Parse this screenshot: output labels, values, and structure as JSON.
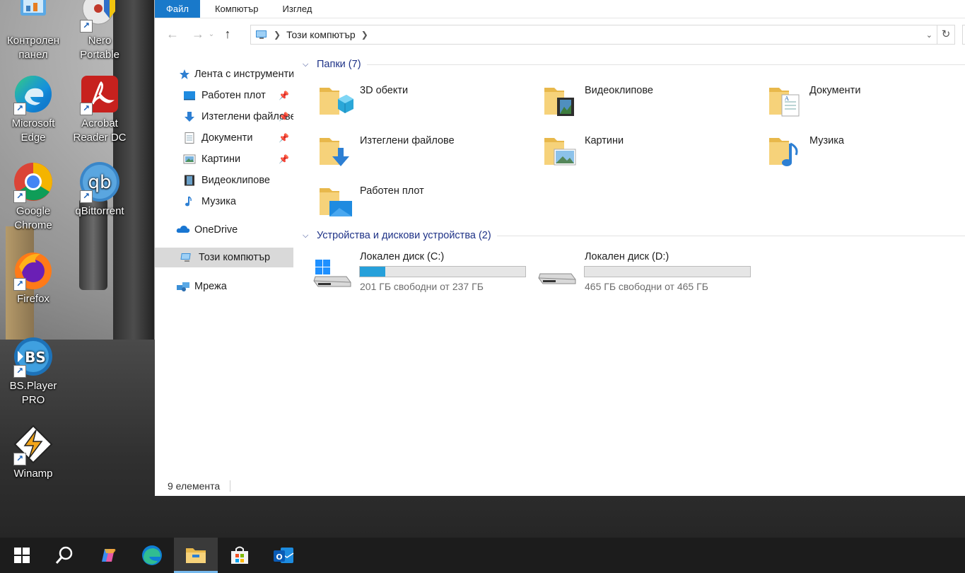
{
  "desktop": {
    "icons": [
      {
        "label": "Контролен панел",
        "icon": "control-panel-icon"
      },
      {
        "label": "Nero Portable",
        "icon": "nero-icon"
      },
      {
        "label": "Microsoft Edge",
        "icon": "edge-icon"
      },
      {
        "label": "Acrobat Reader DC",
        "icon": "acrobat-icon"
      },
      {
        "label": "Google Chrome",
        "icon": "chrome-icon"
      },
      {
        "label": "qBittorrent",
        "icon": "qbittorrent-icon"
      },
      {
        "label": "Firefox",
        "icon": "firefox-icon"
      },
      {
        "label": "BS.Player PRO",
        "icon": "bsplayer-icon"
      },
      {
        "label": "Winamp",
        "icon": "winamp-icon"
      }
    ]
  },
  "ribbon": {
    "tabs": [
      "Файл",
      "Компютър",
      "Изглед"
    ]
  },
  "address": {
    "location": "Този компютър"
  },
  "navpane": {
    "quick_access": "Лента с инструменти",
    "items": [
      {
        "label": "Работен плот",
        "pinned": true
      },
      {
        "label": "Изтеглени файлове",
        "pinned": true
      },
      {
        "label": "Документи",
        "pinned": true
      },
      {
        "label": "Картини",
        "pinned": true
      },
      {
        "label": "Видеоклипове",
        "pinned": false
      },
      {
        "label": "Музика",
        "pinned": false
      }
    ],
    "onedrive": "OneDrive",
    "this_pc": "Този компютър",
    "network": "Мрежа"
  },
  "content": {
    "folders_header": "Папки (7)",
    "folders": [
      {
        "name": "3D обекти",
        "icon": "3d-objects-folder-icon"
      },
      {
        "name": "Видеоклипове",
        "icon": "videos-folder-icon"
      },
      {
        "name": "Документи",
        "icon": "documents-folder-icon"
      },
      {
        "name": "Изтеглени файлове",
        "icon": "downloads-folder-icon"
      },
      {
        "name": "Картини",
        "icon": "pictures-folder-icon"
      },
      {
        "name": "Музика",
        "icon": "music-folder-icon"
      },
      {
        "name": "Работен плот",
        "icon": "desktop-folder-icon"
      }
    ],
    "devices_header": "Устройства и дискови устройства (2)",
    "drives": [
      {
        "name": "Локален диск (C:)",
        "free": "201 ГБ свободни от 237 ГБ",
        "used_fraction": 0.152
      },
      {
        "name": "Локален диск (D:)",
        "free": "465 ГБ свободни от 465 ГБ",
        "used_fraction": 0.0
      }
    ]
  },
  "status": {
    "count": "9 елемента"
  },
  "colors": {
    "accent": "#1979ca",
    "drive_fill": "#26a0da",
    "group_header": "#1e3287",
    "folder_yellow": "#f3c969"
  },
  "taskbar": {
    "items": [
      "start-icon",
      "search-icon",
      "copilot-icon",
      "edge-icon",
      "file-explorer-icon",
      "microsoft-store-icon",
      "outlook-icon"
    ]
  }
}
